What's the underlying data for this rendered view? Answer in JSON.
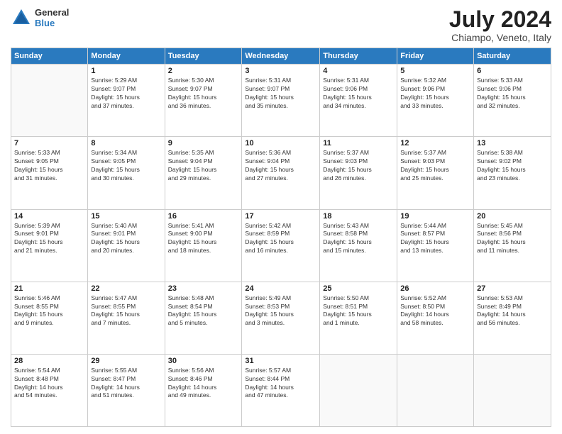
{
  "header": {
    "logo_line1": "General",
    "logo_line2": "Blue",
    "month_year": "July 2024",
    "location": "Chiampo, Veneto, Italy"
  },
  "columns": [
    "Sunday",
    "Monday",
    "Tuesday",
    "Wednesday",
    "Thursday",
    "Friday",
    "Saturday"
  ],
  "weeks": [
    [
      {
        "day": "",
        "info": ""
      },
      {
        "day": "1",
        "info": "Sunrise: 5:29 AM\nSunset: 9:07 PM\nDaylight: 15 hours\nand 37 minutes."
      },
      {
        "day": "2",
        "info": "Sunrise: 5:30 AM\nSunset: 9:07 PM\nDaylight: 15 hours\nand 36 minutes."
      },
      {
        "day": "3",
        "info": "Sunrise: 5:31 AM\nSunset: 9:07 PM\nDaylight: 15 hours\nand 35 minutes."
      },
      {
        "day": "4",
        "info": "Sunrise: 5:31 AM\nSunset: 9:06 PM\nDaylight: 15 hours\nand 34 minutes."
      },
      {
        "day": "5",
        "info": "Sunrise: 5:32 AM\nSunset: 9:06 PM\nDaylight: 15 hours\nand 33 minutes."
      },
      {
        "day": "6",
        "info": "Sunrise: 5:33 AM\nSunset: 9:06 PM\nDaylight: 15 hours\nand 32 minutes."
      }
    ],
    [
      {
        "day": "7",
        "info": "Sunrise: 5:33 AM\nSunset: 9:05 PM\nDaylight: 15 hours\nand 31 minutes."
      },
      {
        "day": "8",
        "info": "Sunrise: 5:34 AM\nSunset: 9:05 PM\nDaylight: 15 hours\nand 30 minutes."
      },
      {
        "day": "9",
        "info": "Sunrise: 5:35 AM\nSunset: 9:04 PM\nDaylight: 15 hours\nand 29 minutes."
      },
      {
        "day": "10",
        "info": "Sunrise: 5:36 AM\nSunset: 9:04 PM\nDaylight: 15 hours\nand 27 minutes."
      },
      {
        "day": "11",
        "info": "Sunrise: 5:37 AM\nSunset: 9:03 PM\nDaylight: 15 hours\nand 26 minutes."
      },
      {
        "day": "12",
        "info": "Sunrise: 5:37 AM\nSunset: 9:03 PM\nDaylight: 15 hours\nand 25 minutes."
      },
      {
        "day": "13",
        "info": "Sunrise: 5:38 AM\nSunset: 9:02 PM\nDaylight: 15 hours\nand 23 minutes."
      }
    ],
    [
      {
        "day": "14",
        "info": "Sunrise: 5:39 AM\nSunset: 9:01 PM\nDaylight: 15 hours\nand 21 minutes."
      },
      {
        "day": "15",
        "info": "Sunrise: 5:40 AM\nSunset: 9:01 PM\nDaylight: 15 hours\nand 20 minutes."
      },
      {
        "day": "16",
        "info": "Sunrise: 5:41 AM\nSunset: 9:00 PM\nDaylight: 15 hours\nand 18 minutes."
      },
      {
        "day": "17",
        "info": "Sunrise: 5:42 AM\nSunset: 8:59 PM\nDaylight: 15 hours\nand 16 minutes."
      },
      {
        "day": "18",
        "info": "Sunrise: 5:43 AM\nSunset: 8:58 PM\nDaylight: 15 hours\nand 15 minutes."
      },
      {
        "day": "19",
        "info": "Sunrise: 5:44 AM\nSunset: 8:57 PM\nDaylight: 15 hours\nand 13 minutes."
      },
      {
        "day": "20",
        "info": "Sunrise: 5:45 AM\nSunset: 8:56 PM\nDaylight: 15 hours\nand 11 minutes."
      }
    ],
    [
      {
        "day": "21",
        "info": "Sunrise: 5:46 AM\nSunset: 8:55 PM\nDaylight: 15 hours\nand 9 minutes."
      },
      {
        "day": "22",
        "info": "Sunrise: 5:47 AM\nSunset: 8:55 PM\nDaylight: 15 hours\nand 7 minutes."
      },
      {
        "day": "23",
        "info": "Sunrise: 5:48 AM\nSunset: 8:54 PM\nDaylight: 15 hours\nand 5 minutes."
      },
      {
        "day": "24",
        "info": "Sunrise: 5:49 AM\nSunset: 8:53 PM\nDaylight: 15 hours\nand 3 minutes."
      },
      {
        "day": "25",
        "info": "Sunrise: 5:50 AM\nSunset: 8:51 PM\nDaylight: 15 hours\nand 1 minute."
      },
      {
        "day": "26",
        "info": "Sunrise: 5:52 AM\nSunset: 8:50 PM\nDaylight: 14 hours\nand 58 minutes."
      },
      {
        "day": "27",
        "info": "Sunrise: 5:53 AM\nSunset: 8:49 PM\nDaylight: 14 hours\nand 56 minutes."
      }
    ],
    [
      {
        "day": "28",
        "info": "Sunrise: 5:54 AM\nSunset: 8:48 PM\nDaylight: 14 hours\nand 54 minutes."
      },
      {
        "day": "29",
        "info": "Sunrise: 5:55 AM\nSunset: 8:47 PM\nDaylight: 14 hours\nand 51 minutes."
      },
      {
        "day": "30",
        "info": "Sunrise: 5:56 AM\nSunset: 8:46 PM\nDaylight: 14 hours\nand 49 minutes."
      },
      {
        "day": "31",
        "info": "Sunrise: 5:57 AM\nSunset: 8:44 PM\nDaylight: 14 hours\nand 47 minutes."
      },
      {
        "day": "",
        "info": ""
      },
      {
        "day": "",
        "info": ""
      },
      {
        "day": "",
        "info": ""
      }
    ]
  ]
}
